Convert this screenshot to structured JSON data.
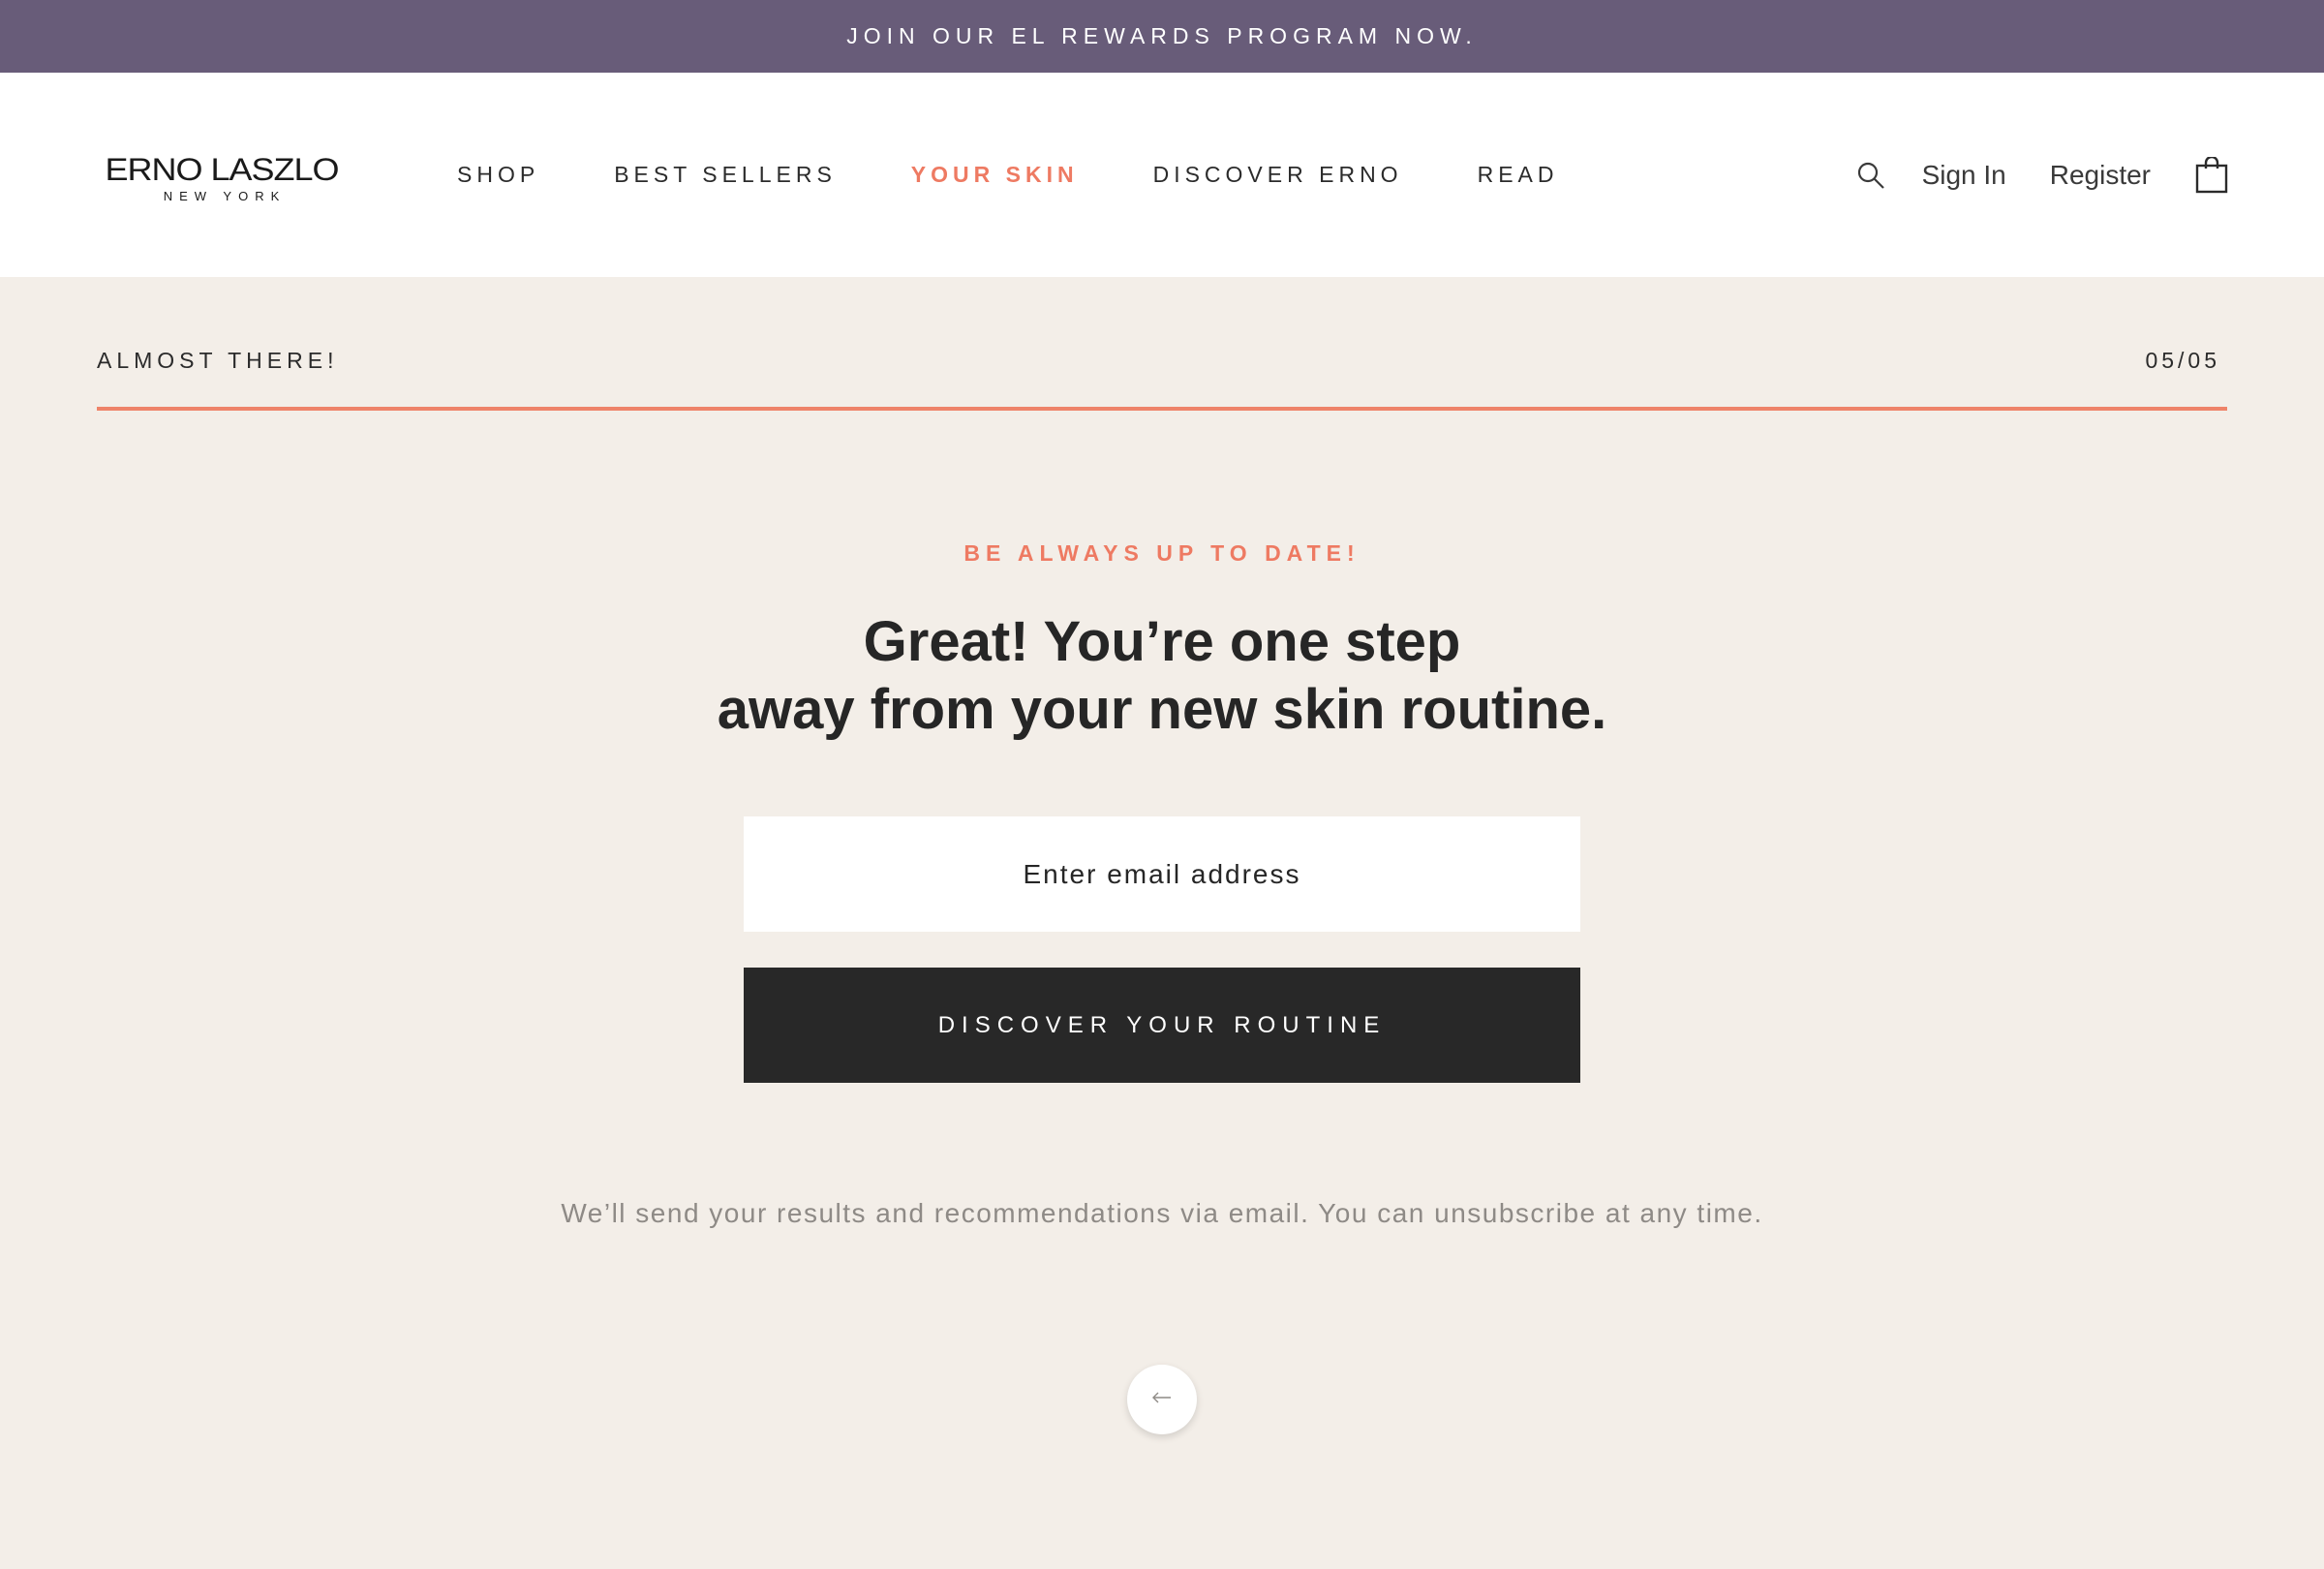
{
  "promo": {
    "text": "JOIN OUR EL REWARDS PROGRAM NOW."
  },
  "header": {
    "logo": {
      "wordmark": "ERNO LASZLO",
      "sub": "NEW YORK"
    },
    "nav": [
      {
        "label": "SHOP",
        "active": false
      },
      {
        "label": "BEST SELLERS",
        "active": false
      },
      {
        "label": "YOUR SKIN",
        "active": true
      },
      {
        "label": "DISCOVER ERNO",
        "active": false
      },
      {
        "label": "READ",
        "active": false
      }
    ],
    "sign_in": "Sign In",
    "register": "Register",
    "icons": {
      "search": "search-icon",
      "cart": "shopping-bag-icon"
    }
  },
  "progress": {
    "label": "ALMOST THERE!",
    "count": "05/05",
    "fraction": 1.0
  },
  "main": {
    "eyebrow": "BE ALWAYS UP TO DATE!",
    "headline_line1": "Great! You’re one step",
    "headline_line2": "away from your new skin routine.",
    "email_placeholder": "Enter email address",
    "submit_label": "DISCOVER YOUR ROUTINE",
    "disclaimer": "We’ll send your results and recommendations via email. You can unsubscribe at any time.",
    "back_icon": "arrow-left-icon"
  },
  "colors": {
    "promo_bg": "#685c79",
    "accent": "#ee7a62",
    "page_bg": "#f3eee8",
    "button_bg": "#282828"
  }
}
